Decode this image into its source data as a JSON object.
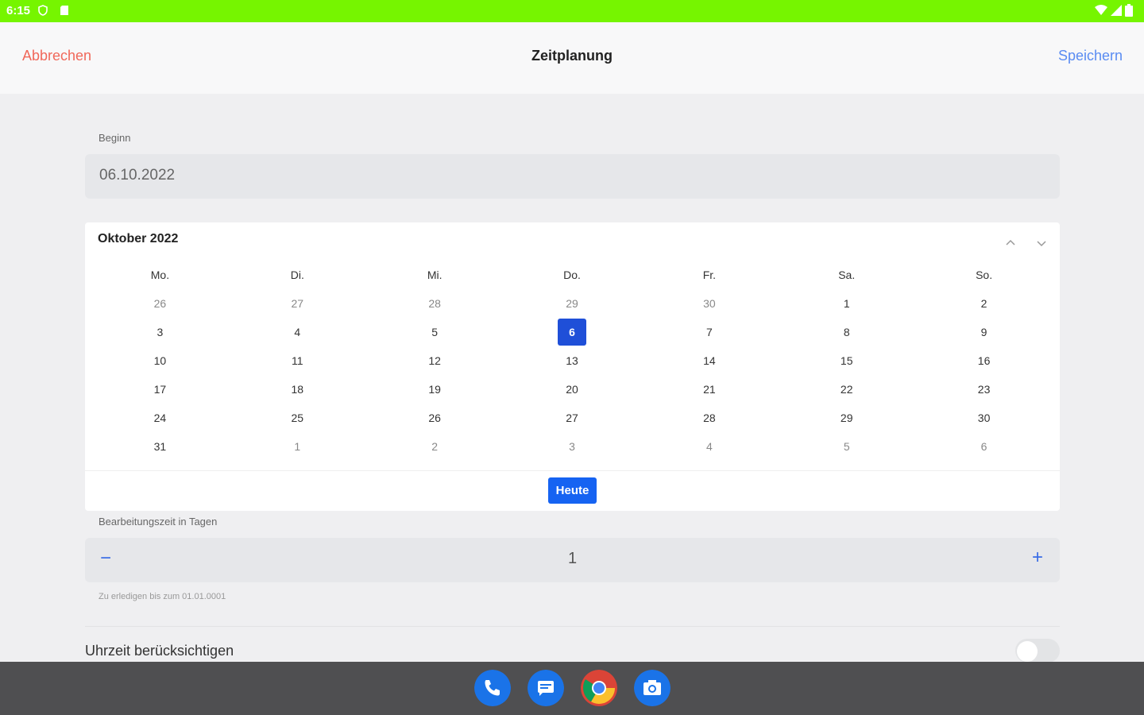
{
  "status_bar": {
    "time": "6:15"
  },
  "header": {
    "cancel_label": "Abbrechen",
    "title": "Zeitplanung",
    "save_label": "Speichern"
  },
  "start": {
    "label": "Beginn",
    "value": "06.10.2022"
  },
  "calendar": {
    "month_label": "Oktober 2022",
    "weekdays": [
      "Mo.",
      "Di.",
      "Mi.",
      "Do.",
      "Fr.",
      "Sa.",
      "So."
    ],
    "weeks": [
      [
        "26",
        "27",
        "28",
        "29",
        "30",
        "1",
        "2"
      ],
      [
        "3",
        "4",
        "5",
        "6",
        "7",
        "8",
        "9"
      ],
      [
        "10",
        "11",
        "12",
        "13",
        "14",
        "15",
        "16"
      ],
      [
        "17",
        "18",
        "19",
        "20",
        "21",
        "22",
        "23"
      ],
      [
        "24",
        "25",
        "26",
        "27",
        "28",
        "29",
        "30"
      ],
      [
        "31",
        "1",
        "2",
        "3",
        "4",
        "5",
        "6"
      ]
    ],
    "selected_day": "6",
    "today_label": "Heute"
  },
  "processing": {
    "label": "Bearbeitungszeit in Tagen",
    "value": "1",
    "hint": "Zu erledigen bis zum 01.01.0001"
  },
  "time_toggle": {
    "label": "Uhrzeit berücksichtigen",
    "on": false
  },
  "colors": {
    "status_bar": "#76f500",
    "accent": "#1f4fd8",
    "cancel": "#f0685a",
    "save": "#5a8cf2"
  },
  "dock": {
    "apps": [
      "phone-icon",
      "messages-icon",
      "chrome-icon",
      "camera-icon"
    ]
  }
}
